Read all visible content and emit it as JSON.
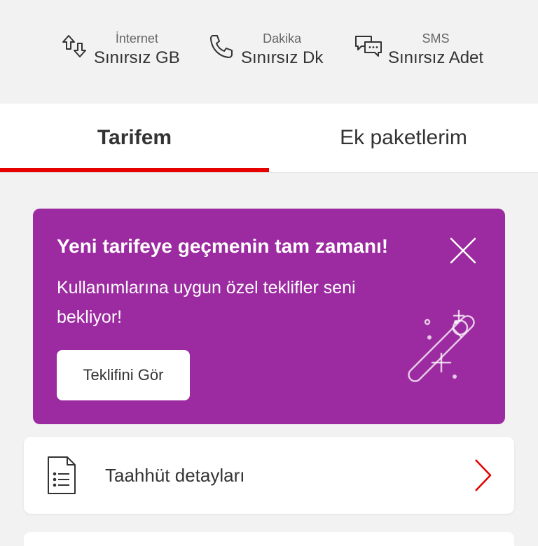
{
  "usage": {
    "internet": {
      "label": "İnternet",
      "value": "Sınırsız GB",
      "icon": "data-transfer-icon"
    },
    "minutes": {
      "label": "Dakika",
      "value": "Sınırsız Dk",
      "icon": "phone-icon"
    },
    "sms": {
      "label": "SMS",
      "value": "Sınırsız Adet",
      "icon": "chat-bubbles-icon"
    }
  },
  "tabs": [
    {
      "label": "Tarifem",
      "active": true
    },
    {
      "label": "Ek paketlerim",
      "active": false
    }
  ],
  "promo": {
    "title": "Yeni tarifeye geçmenin tam zamanı!",
    "description": "Kullanımlarına uygun özel teklifler seni bekliyor!",
    "button_label": "Teklifini Gör",
    "background": "#9c2aa0",
    "close_icon": "close-icon",
    "art_icon": "magic-wand-icon"
  },
  "list": [
    {
      "label": "Taahhüt detayları",
      "icon": "document-icon"
    }
  ],
  "colors": {
    "accent": "#e60000",
    "promo": "#9c2aa0"
  }
}
